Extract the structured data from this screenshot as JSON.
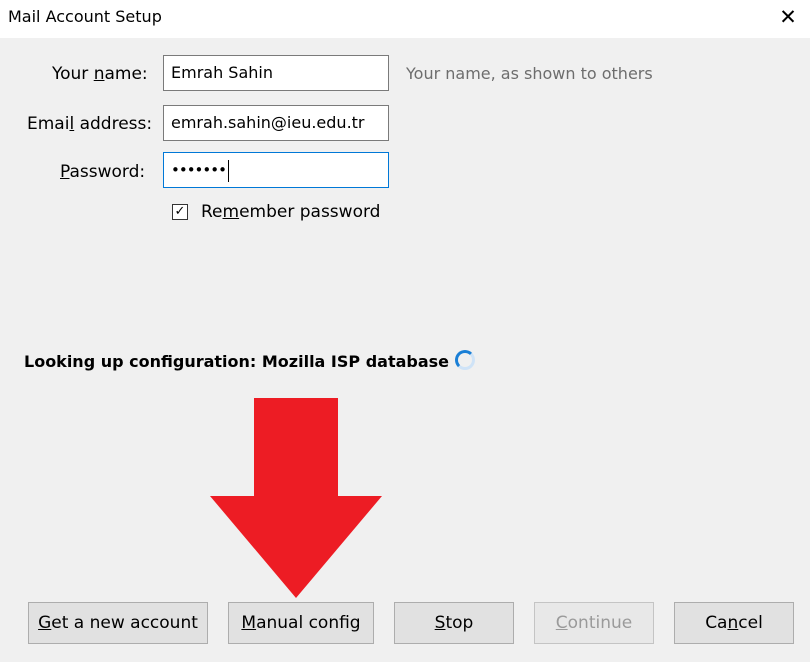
{
  "dialog": {
    "title": "Mail Account Setup",
    "close_glyph": "✕"
  },
  "form": {
    "name_label_pre": "Your ",
    "name_label_key": "n",
    "name_label_post": "ame:",
    "name_value": "Emrah Sahin",
    "name_hint": "Your name, as shown to others",
    "email_label_pre": "Emai",
    "email_label_key": "l",
    "email_label_post": " address:",
    "email_value": "emrah.sahin@ieu.edu.tr",
    "password_label_key": "P",
    "password_label_post": "assword:",
    "password_value": "•••••••",
    "remember_checked": true,
    "remember_glyph": "✓",
    "remember_pre": "Re",
    "remember_key": "m",
    "remember_post": "ember password"
  },
  "status": {
    "text": "Looking up configuration: Mozilla ISP database",
    "spinner_icon": "loading-spinner"
  },
  "annotation": {
    "arrow_color": "#ed1c24"
  },
  "buttons": {
    "get_account_key": "G",
    "get_account_post": "et a new account",
    "manual_key": "M",
    "manual_post": "anual config",
    "stop_key": "S",
    "stop_post": "top",
    "continue_key": "C",
    "continue_post": "ontinue",
    "cancel_pre": "Ca",
    "cancel_key": "n",
    "cancel_post": "cel"
  },
  "colors": {
    "focus_border": "#0078d7",
    "spinner": "#1a7fd6"
  }
}
